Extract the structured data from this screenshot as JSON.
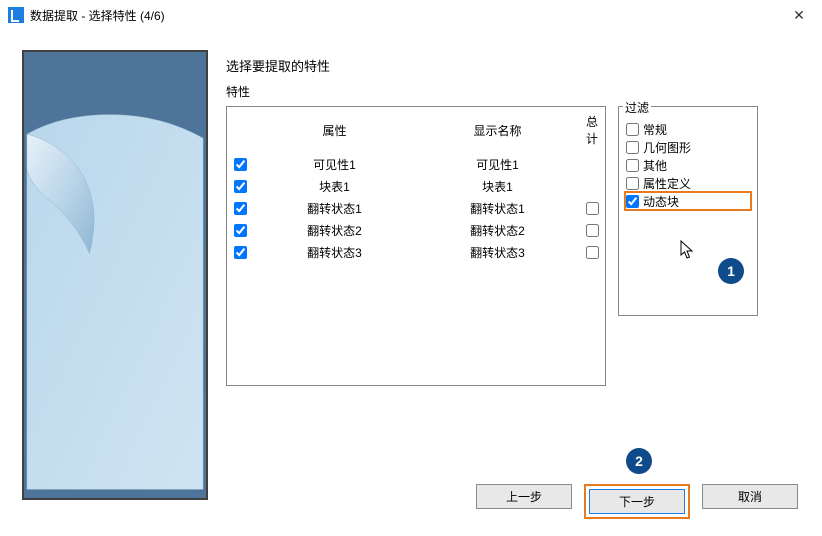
{
  "window": {
    "title": "数据提取 - 选择特性 (4/6)"
  },
  "main": {
    "heading": "选择要提取的特性",
    "sub_heading": "特性",
    "table": {
      "headers": {
        "attr": "属性",
        "display": "显示名称",
        "total": "总计"
      },
      "rows": [
        {
          "selected": true,
          "attr": "可见性1",
          "display": "可见性1",
          "total_cb": false,
          "has_total": false
        },
        {
          "selected": true,
          "attr": "块表1",
          "display": "块表1",
          "total_cb": false,
          "has_total": false
        },
        {
          "selected": true,
          "attr": "翻转状态1",
          "display": "翻转状态1",
          "total_cb": false,
          "has_total": true
        },
        {
          "selected": true,
          "attr": "翻转状态2",
          "display": "翻转状态2",
          "total_cb": false,
          "has_total": true
        },
        {
          "selected": true,
          "attr": "翻转状态3",
          "display": "翻转状态3",
          "total_cb": false,
          "has_total": true
        }
      ]
    },
    "filter": {
      "title": "过滤",
      "items": [
        {
          "label": "常规",
          "checked": false,
          "highlighted": false
        },
        {
          "label": "几何图形",
          "checked": false,
          "highlighted": false
        },
        {
          "label": "其他",
          "checked": false,
          "highlighted": false
        },
        {
          "label": "属性定义",
          "checked": false,
          "highlighted": false
        },
        {
          "label": "动态块",
          "checked": true,
          "highlighted": true
        }
      ]
    }
  },
  "annotations": {
    "badge1": "1",
    "badge2": "2"
  },
  "footer": {
    "prev": "上一步",
    "next": "下一步",
    "cancel": "取消"
  }
}
